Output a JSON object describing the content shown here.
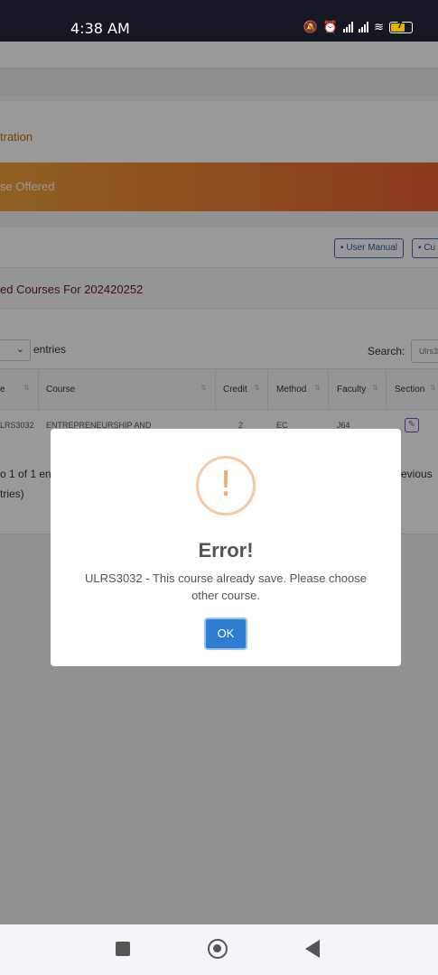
{
  "status_bar": {
    "time": "4:38 AM",
    "battery": "7"
  },
  "page": {
    "breadcrumb": "tration",
    "banner": "se Offered",
    "buttons": {
      "user_manual": "User Manual",
      "second": "Cu"
    },
    "section_title": "ed Courses For 202420252",
    "length_value": "",
    "entries_label": "entries",
    "search_label": "Search:",
    "search_value": "Ulrs3",
    "table": {
      "columns": [
        "e",
        "Course",
        "Credit",
        "Method",
        "Faculty",
        "Section"
      ],
      "row": {
        "code": "LRS3032",
        "course": "ENTREPRENEURSHIP AND",
        "credit": "2",
        "method": "EC",
        "faculty": "J64"
      }
    },
    "info_line1": "o 1 of 1 en",
    "info_line2": "tries)",
    "previous": "revious"
  },
  "modal": {
    "icon": "!",
    "title": "Error!",
    "message": "ULRS3032 - This course already save. Please choose other course.",
    "ok_label": "OK"
  },
  "colors": {
    "banner_start": "#f0a03a",
    "banner_end": "#e8622e",
    "ok_button": "#2f7dd1",
    "warning": "#f5a86e"
  }
}
